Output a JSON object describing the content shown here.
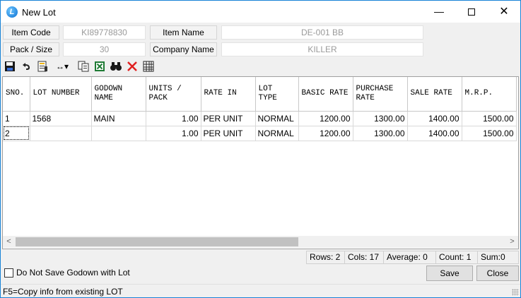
{
  "window": {
    "title": "New Lot",
    "minimize_glyph": "—",
    "close_glyph": "✕",
    "app_icon": "app-logo-icon"
  },
  "fields": {
    "item_code": {
      "label": "Item Code",
      "value": "KI89778830"
    },
    "item_name": {
      "label": "Item Name",
      "value": "DE-001 BB"
    },
    "pack_size": {
      "label": "Pack / Size",
      "value": "30"
    },
    "company_name": {
      "label": "Company Name",
      "value": "KILLER"
    }
  },
  "toolbar": {
    "icons": [
      "save-icon",
      "undo-icon",
      "report-icon",
      "column-width-icon",
      "copy-icon",
      "excel-icon",
      "find-icon",
      "delete-icon",
      "grid-icon"
    ],
    "column_width_glyph": "↔▾"
  },
  "grid": {
    "columns": [
      "SNO.",
      "LOT NUMBER",
      "GODOWN NAME",
      "UNITS / PACK",
      "RATE IN",
      "LOT TYPE",
      "BASIC RATE",
      "PURCHASE RATE",
      "SALE RATE",
      "M.R.P."
    ],
    "rows": [
      [
        "1",
        "1568",
        "MAIN",
        "1.00",
        "PER UNIT",
        "NORMAL",
        "1200.00",
        "1300.00",
        "1400.00",
        "1500.00"
      ],
      [
        "2",
        "",
        "",
        "1.00",
        "PER UNIT",
        "NORMAL",
        "1200.00",
        "1300.00",
        "1400.00",
        "1500.00"
      ]
    ]
  },
  "scrollbar": {
    "left_glyph": "<",
    "right_glyph": ">"
  },
  "status": {
    "rows": "Rows: 2",
    "cols": "Cols: 17",
    "average": "Average: 0",
    "count": "Count: 1",
    "sum": "Sum:0"
  },
  "options": {
    "do_not_save_godown_label": "Do Not Save Godown with Lot",
    "do_not_save_godown_checked": false
  },
  "buttons": {
    "save": "Save",
    "close": "Close"
  },
  "statusbar": {
    "hint": "F5=Copy info from existing LOT"
  },
  "colors": {
    "window_border": "#1883d7",
    "grid_line": "#d9d9d9",
    "background": "#f0f0f0"
  }
}
